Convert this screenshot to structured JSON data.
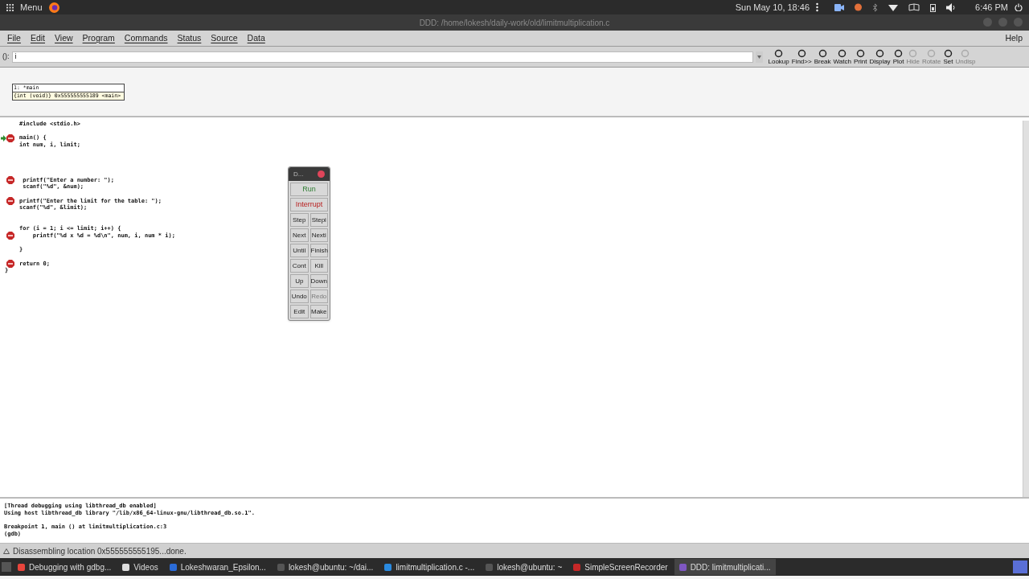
{
  "top_panel": {
    "menu_label": "Menu",
    "date": "Sun May 10, 18:46",
    "clock": "6:46 PM"
  },
  "window": {
    "title": "DDD: /home/lokesh/daily-work/old/limitmultiplication.c"
  },
  "menubar": {
    "items": [
      "File",
      "Edit",
      "View",
      "Program",
      "Commands",
      "Status",
      "Source",
      "Data"
    ],
    "help": "Help"
  },
  "argument": {
    "label": "():",
    "value": "i"
  },
  "toolbar": [
    {
      "label": "Lookup",
      "disabled": false
    },
    {
      "label": "Find>>",
      "disabled": false
    },
    {
      "label": "Break",
      "disabled": false
    },
    {
      "label": "Watch",
      "disabled": false
    },
    {
      "label": "Print",
      "disabled": false
    },
    {
      "label": "Display",
      "disabled": false
    },
    {
      "label": "Plot",
      "disabled": false
    },
    {
      "label": "Hide",
      "disabled": true
    },
    {
      "label": "Rotate",
      "disabled": true
    },
    {
      "label": "Set",
      "disabled": false
    },
    {
      "label": "Undisp",
      "disabled": true
    }
  ],
  "data_display": {
    "title": "1: *main",
    "value": "{int (void)} 0x555555555189 <main>"
  },
  "source": [
    {
      "kind": "code",
      "text": "#include <stdio.h>",
      "breakpoint": false,
      "current": false
    },
    {
      "kind": "blank"
    },
    {
      "kind": "code",
      "text": "main() {",
      "breakpoint": true,
      "current": true
    },
    {
      "kind": "code",
      "text": "int num, i, limit;",
      "breakpoint": false,
      "current": false
    },
    {
      "kind": "blank"
    },
    {
      "kind": "blank"
    },
    {
      "kind": "blank"
    },
    {
      "kind": "blank"
    },
    {
      "kind": "code",
      "text": " printf(\"Enter a number: \");",
      "breakpoint": true,
      "current": false
    },
    {
      "kind": "code",
      "text": " scanf(\"%d\", &num);",
      "breakpoint": false,
      "current": false
    },
    {
      "kind": "blank"
    },
    {
      "kind": "code",
      "text": "printf(\"Enter the limit for the table: \");",
      "breakpoint": true,
      "current": false
    },
    {
      "kind": "code",
      "text": "scanf(\"%d\", &limit);",
      "breakpoint": false,
      "current": false
    },
    {
      "kind": "blank"
    },
    {
      "kind": "blank"
    },
    {
      "kind": "code",
      "text": "for (i = 1; i <= limit; i++) {",
      "breakpoint": false,
      "current": false
    },
    {
      "kind": "code",
      "text": "    printf(\"%d x %d = %d\\n\", num, i, num * i);",
      "breakpoint": true,
      "current": false
    },
    {
      "kind": "blank"
    },
    {
      "kind": "code",
      "text": "}",
      "breakpoint": false,
      "current": false
    },
    {
      "kind": "blank"
    },
    {
      "kind": "code",
      "text": "return 0;",
      "breakpoint": true,
      "current": false
    },
    {
      "kind": "outdented",
      "text": "}"
    }
  ],
  "command_tool": {
    "title": "D...",
    "wide": [
      {
        "label": "Run",
        "kind": "run"
      },
      {
        "label": "Interrupt",
        "kind": "interrupt"
      }
    ],
    "buttons": [
      {
        "label": "Step",
        "disabled": false
      },
      {
        "label": "Stepi",
        "disabled": false
      },
      {
        "label": "Next",
        "disabled": false
      },
      {
        "label": "Nexti",
        "disabled": false
      },
      {
        "label": "Until",
        "disabled": false
      },
      {
        "label": "Finish",
        "disabled": false
      },
      {
        "label": "Cont",
        "disabled": false
      },
      {
        "label": "Kill",
        "disabled": false
      },
      {
        "label": "Up",
        "disabled": false
      },
      {
        "label": "Down",
        "disabled": false
      },
      {
        "label": "Undo",
        "disabled": false
      },
      {
        "label": "Redo",
        "disabled": true
      },
      {
        "label": "Edit",
        "disabled": false
      },
      {
        "label": "Make",
        "disabled": false
      }
    ]
  },
  "console": [
    {
      "text": "[Thread debugging using libthread_db enabled]",
      "space_before": false
    },
    {
      "text": "Using host libthread_db library \"/lib/x86_64-linux-gnu/libthread_db.so.1\".",
      "space_before": false
    },
    {
      "text": "Breakpoint 1, main () at limitmultiplication.c:3",
      "space_before": true
    },
    {
      "text": "(gdb)",
      "space_before": false
    }
  ],
  "status_bar": "Disassembling location 0x555555555195...done.",
  "taskbar": [
    {
      "label": "Debugging with gdbg...",
      "color": "#e8453c",
      "selected": false
    },
    {
      "label": "Videos",
      "color": "#dddddd",
      "selected": false
    },
    {
      "label": "Lokeshwaran_Epsilon...",
      "color": "#2b6cd8",
      "selected": false
    },
    {
      "label": "lokesh@ubuntu: ~/dai...",
      "color": "#555555",
      "selected": false
    },
    {
      "label": "limitmultiplication.c -...",
      "color": "#2a8ae0",
      "selected": false
    },
    {
      "label": "lokesh@ubuntu: ~",
      "color": "#555555",
      "selected": false
    },
    {
      "label": "SimpleScreenRecorder",
      "color": "#c62828",
      "selected": false
    },
    {
      "label": "DDD: limitmultiplicati...",
      "color": "#7e57c2",
      "selected": true
    }
  ]
}
